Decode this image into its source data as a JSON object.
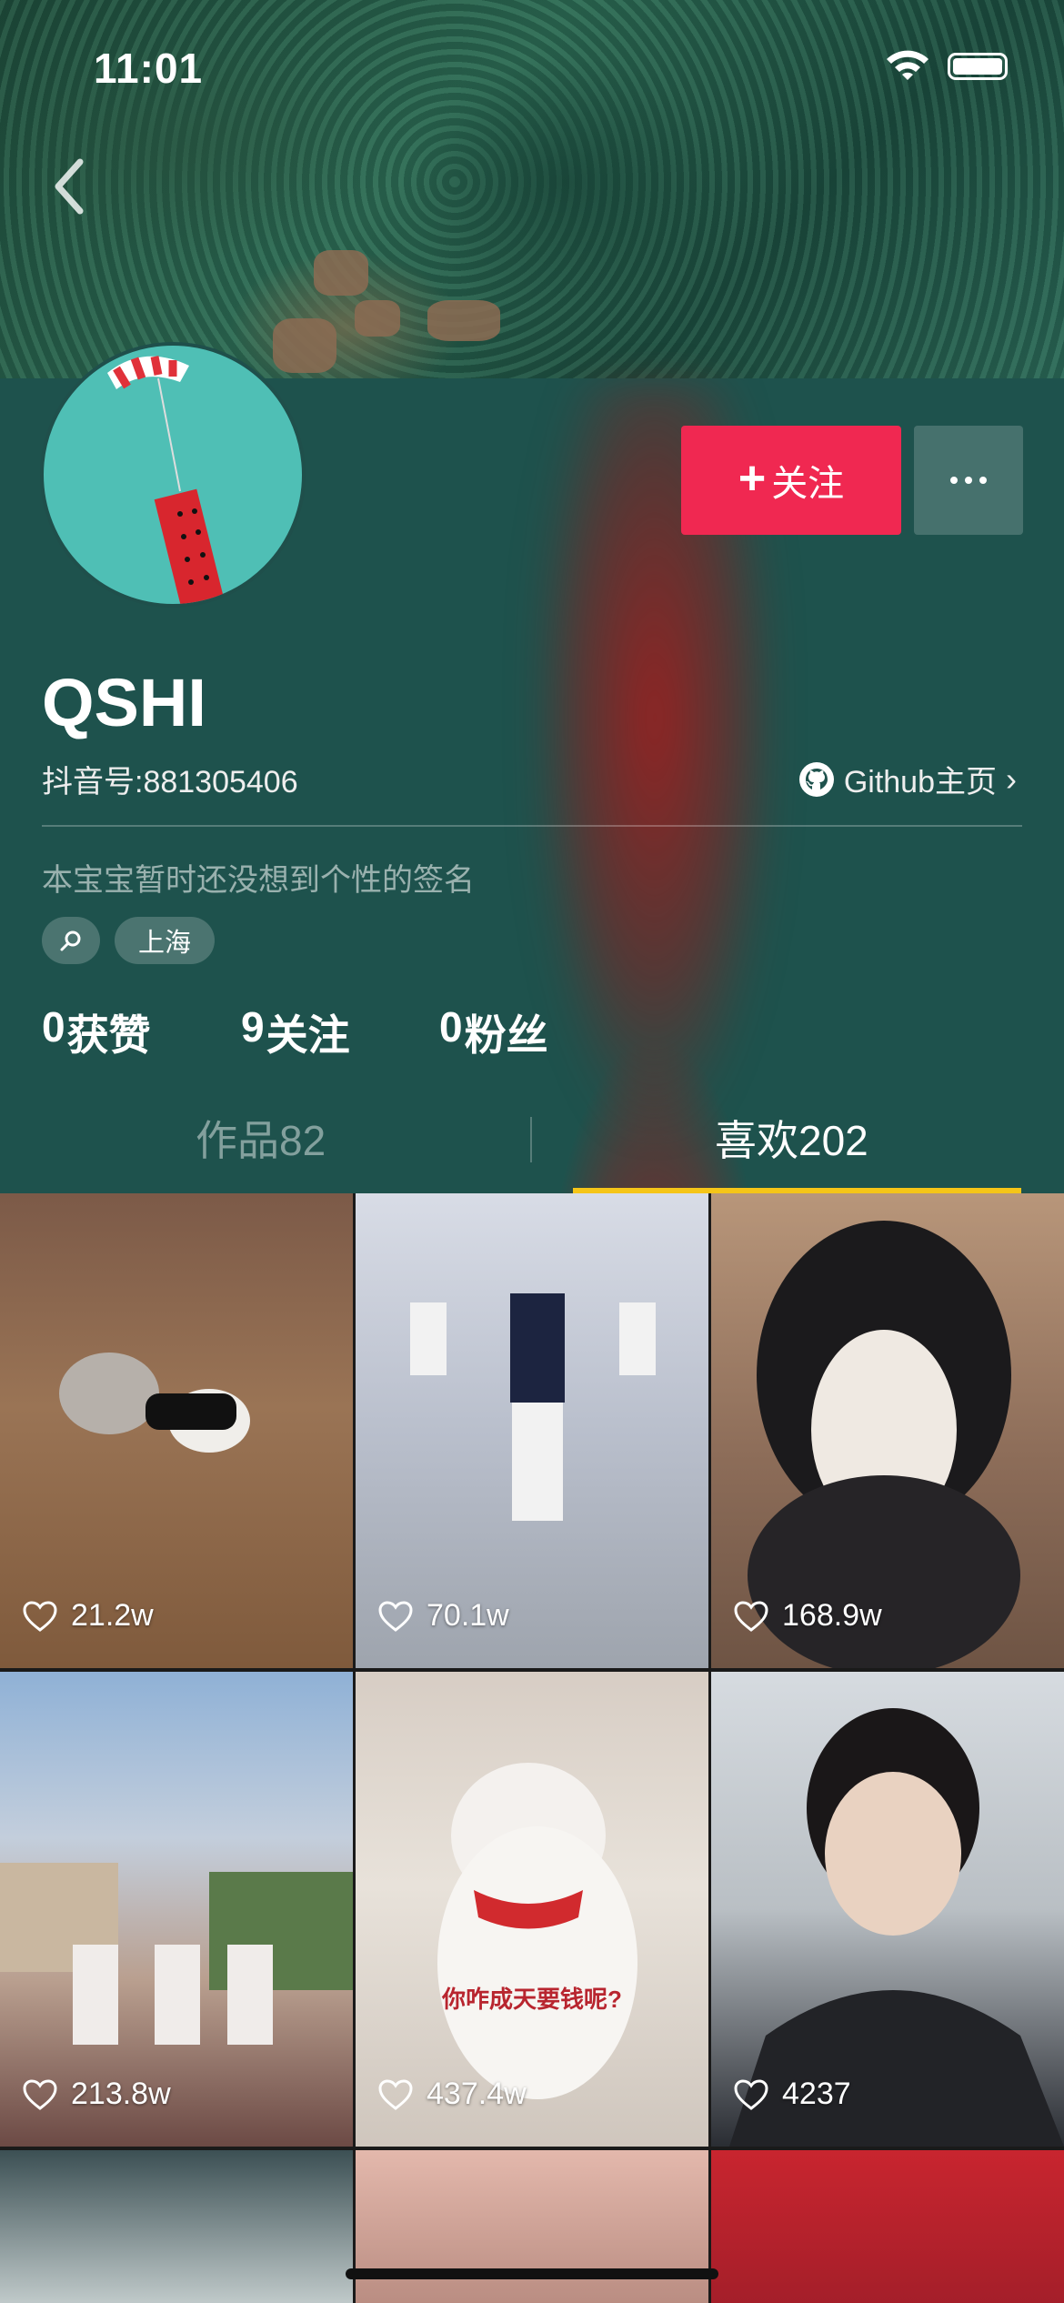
{
  "status_bar": {
    "time": "11:01"
  },
  "profile": {
    "nickname": "QSHI",
    "douyin_id": "抖音号:881305406",
    "github_label": "Github主页",
    "signature": "本宝宝暂时还没想到个性的签名",
    "tags": {
      "search_icon": "search-icon",
      "city": "上海"
    },
    "follow_label": "关注",
    "stats": {
      "likes": "0",
      "likes_label": "获赞",
      "following": "9",
      "following_label": "关注",
      "fans": "0",
      "fans_label": "粉丝"
    }
  },
  "tabs": {
    "works": "作品82",
    "likes": "喜欢202",
    "active": "likes"
  },
  "videos": [
    {
      "likes": "21.2w"
    },
    {
      "likes": "70.1w"
    },
    {
      "likes": "168.9w"
    },
    {
      "likes": "213.8w"
    },
    {
      "likes": "437.4w",
      "caption": "你咋成天要钱呢?"
    },
    {
      "likes": "4237"
    },
    {
      "likes": ""
    },
    {
      "likes": ""
    },
    {
      "likes": ""
    }
  ],
  "colors": {
    "follow": "#f02851",
    "tab_indicator": "#f5c518",
    "panel": "#1e524d"
  }
}
